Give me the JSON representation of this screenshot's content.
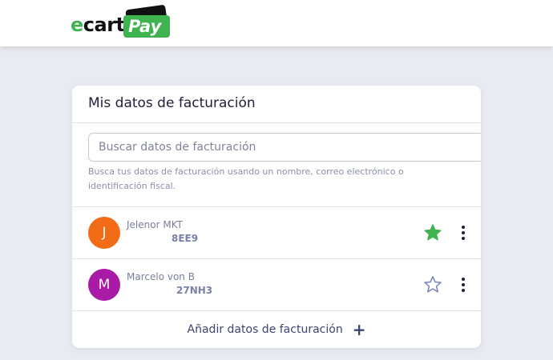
{
  "brand": {
    "logo_text_prefix": "e",
    "logo_text_rest": "cart",
    "logo_text_pay": "Pay",
    "green": "#3fb34f",
    "dark": "#111111"
  },
  "card": {
    "title": "Mis datos de facturación",
    "search": {
      "placeholder": "Buscar datos de facturación",
      "value": ""
    },
    "help_text": "Busca tus datos de facturación usando un nombre, correo electrónico o identificación fiscal.",
    "entries": [
      {
        "initial": "J",
        "name": "Jelenor MKT",
        "id": "8EE9",
        "avatar_color": "#f26b16",
        "favorite": true,
        "icons": {
          "star": "star-filled-icon",
          "menu": "more-vertical-icon"
        }
      },
      {
        "initial": "M",
        "name": "Marcelo von B",
        "id": "27NH3",
        "avatar_color": "#a91aa6",
        "favorite": false,
        "icons": {
          "star": "star-outline-icon",
          "menu": "more-vertical-icon"
        }
      }
    ],
    "add_label": "Añadir datos de facturación",
    "add_icon": "plus-icon",
    "colors": {
      "star_filled": "#3fb34f",
      "star_outline": "#7f89b8"
    }
  }
}
